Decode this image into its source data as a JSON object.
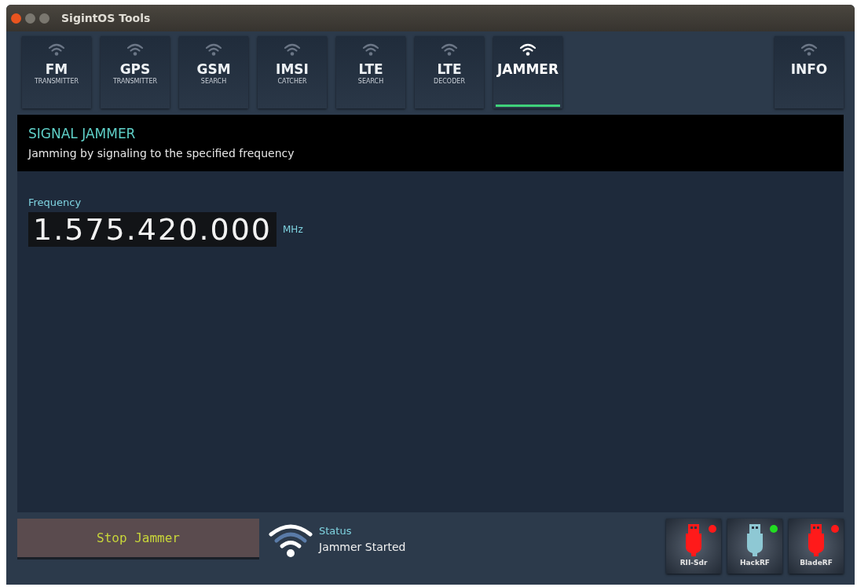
{
  "window": {
    "title": "SigintOS Tools"
  },
  "tabs": [
    {
      "title": "FM",
      "subtitle": "TRANSMITTER",
      "selected": false
    },
    {
      "title": "GPS",
      "subtitle": "TRANSMITTER",
      "selected": false
    },
    {
      "title": "GSM",
      "subtitle": "SEARCH",
      "selected": false
    },
    {
      "title": "IMSI",
      "subtitle": "CATCHER",
      "selected": false
    },
    {
      "title": "LTE",
      "subtitle": "SEARCH",
      "selected": false
    },
    {
      "title": "LTE",
      "subtitle": "DECODER",
      "selected": false
    },
    {
      "title": "JAMMER",
      "selected": true
    }
  ],
  "info_tab": {
    "title": "INFO",
    "selected": false
  },
  "header": {
    "title": "SIGNAL JAMMER",
    "description": "Jamming by signaling to the specified frequency"
  },
  "frequency": {
    "label": "Frequency",
    "value": "1.575.420.000",
    "unit": "MHz"
  },
  "stop_button": {
    "label": "Stop Jammer"
  },
  "status": {
    "label": "Status",
    "value": "Jammer Started"
  },
  "devices": [
    {
      "name": "RII-Sdr",
      "connected": false
    },
    {
      "name": "HackRF",
      "connected": true
    },
    {
      "name": "BladeRF",
      "connected": false
    }
  ]
}
